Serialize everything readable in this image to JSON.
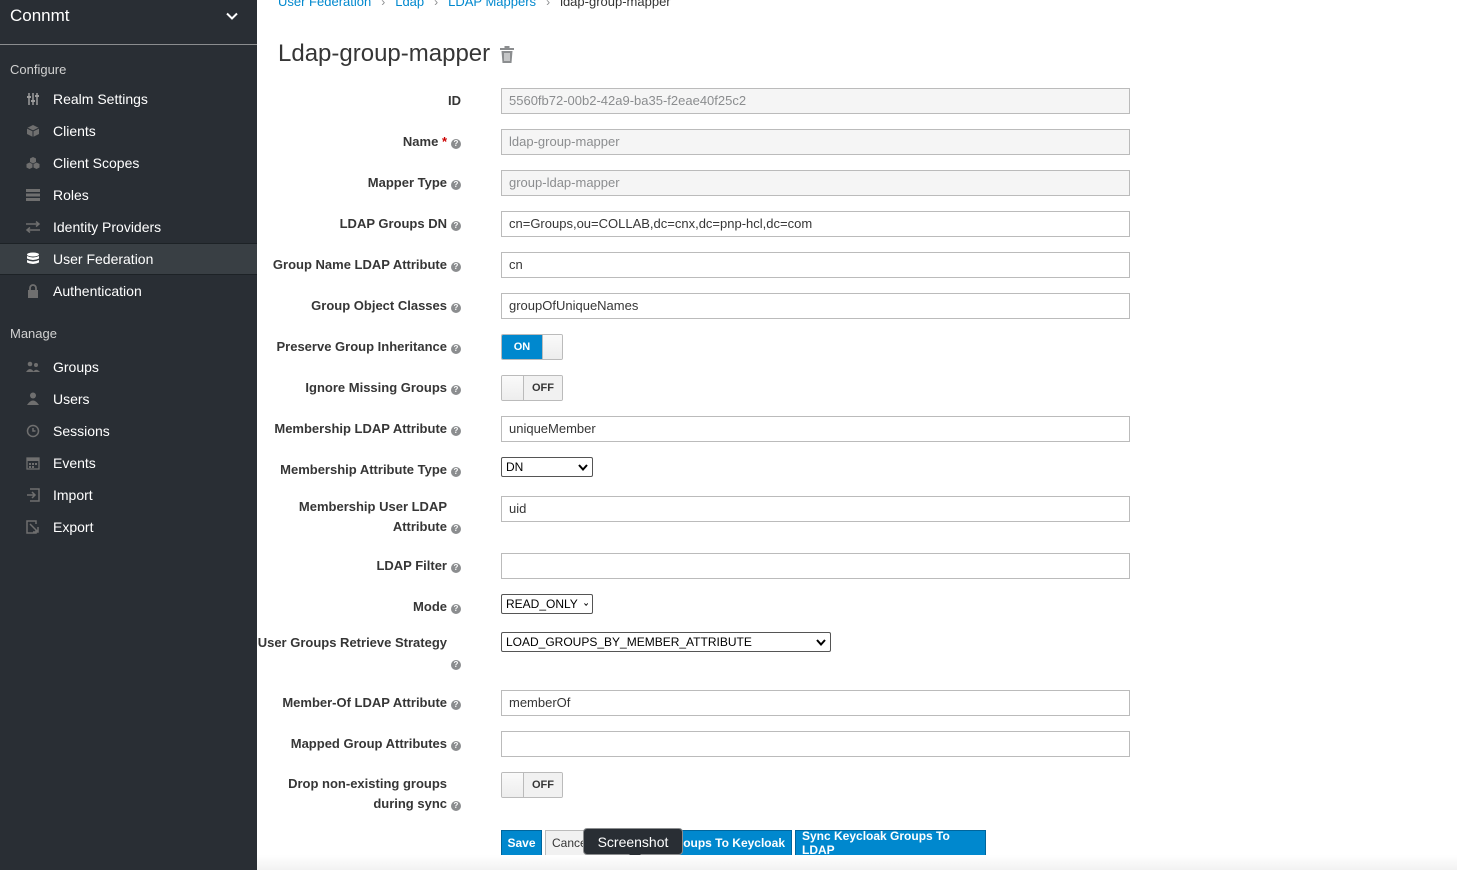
{
  "sidebar": {
    "realm": "Connmt",
    "sections": [
      {
        "label": "Configure"
      },
      {
        "label": "Manage"
      }
    ],
    "configure_items": [
      {
        "label": "Realm Settings",
        "icon": "sliders-icon"
      },
      {
        "label": "Clients",
        "icon": "cube-icon"
      },
      {
        "label": "Client Scopes",
        "icon": "cubes-icon"
      },
      {
        "label": "Roles",
        "icon": "list-icon"
      },
      {
        "label": "Identity Providers",
        "icon": "exchange-icon"
      },
      {
        "label": "User Federation",
        "icon": "database-icon",
        "active": true
      },
      {
        "label": "Authentication",
        "icon": "lock-icon"
      }
    ],
    "manage_items": [
      {
        "label": "Groups",
        "icon": "users-icon"
      },
      {
        "label": "Users",
        "icon": "user-icon"
      },
      {
        "label": "Sessions",
        "icon": "clock-icon"
      },
      {
        "label": "Events",
        "icon": "calendar-icon"
      },
      {
        "label": "Import",
        "icon": "import-icon"
      },
      {
        "label": "Export",
        "icon": "export-icon"
      }
    ]
  },
  "breadcrumb": [
    "User Federation",
    "Ldap",
    "LDAP Mappers",
    "ldap-group-mapper"
  ],
  "title": "Ldap-group-mapper",
  "form": {
    "id": {
      "label": "ID",
      "value": "5560fb72-00b2-42a9-ba35-f2eae40f25c2"
    },
    "name": {
      "label": "Name",
      "required": "*",
      "value": "ldap-group-mapper"
    },
    "mapper_type": {
      "label": "Mapper Type",
      "value": "group-ldap-mapper"
    },
    "groups_dn": {
      "label": "LDAP Groups DN",
      "value": "cn=Groups,ou=COLLAB,dc=cnx,dc=pnp-hcl,dc=com"
    },
    "group_name_attr": {
      "label": "Group Name LDAP Attribute",
      "value": "cn"
    },
    "group_object_classes": {
      "label": "Group Object Classes",
      "value": "groupOfUniqueNames"
    },
    "preserve_inheritance": {
      "label": "Preserve Group Inheritance",
      "state": "ON"
    },
    "ignore_missing": {
      "label": "Ignore Missing Groups",
      "state": "OFF"
    },
    "membership_attr": {
      "label": "Membership LDAP Attribute",
      "value": "uniqueMember"
    },
    "membership_attr_type": {
      "label": "Membership Attribute Type",
      "value": "DN"
    },
    "membership_user_attr": {
      "label_1": "Membership User LDAP",
      "label_2": "Attribute",
      "value": "uid"
    },
    "ldap_filter": {
      "label": "LDAP Filter",
      "value": ""
    },
    "mode": {
      "label": "Mode",
      "value": "READ_ONLY"
    },
    "retrieve_strategy": {
      "label": "User Groups Retrieve Strategy",
      "value": "LOAD_GROUPS_BY_MEMBER_ATTRIBUTE"
    },
    "member_of_attr": {
      "label": "Member-Of LDAP Attribute",
      "value": "memberOf"
    },
    "mapped_group_attrs": {
      "label": "Mapped Group Attributes",
      "value": ""
    },
    "drop_non_existing": {
      "label_1": "Drop non-existing groups",
      "label_2": "during sync",
      "state": "OFF"
    }
  },
  "buttons": {
    "save": "Save",
    "cancel": "Cance",
    "sync_to_keycloak": "oups To Keycloak",
    "sync_to_ldap": "Sync Keycloak Groups To LDAP"
  },
  "tooltip": "Screenshot"
}
